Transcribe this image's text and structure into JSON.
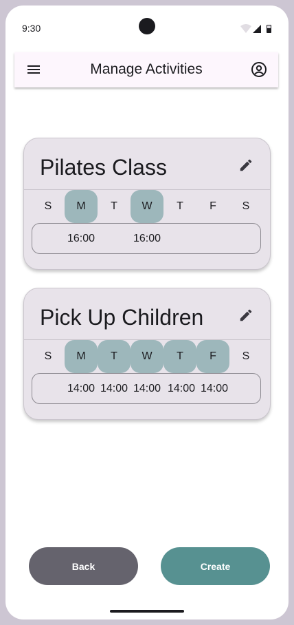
{
  "status_bar": {
    "time": "9:30"
  },
  "app_bar": {
    "title": "Manage Activities"
  },
  "activities": [
    {
      "title": "Pilates Class",
      "days": [
        {
          "label": "S",
          "selected": false,
          "time": ""
        },
        {
          "label": "M",
          "selected": true,
          "time": "16:00"
        },
        {
          "label": "T",
          "selected": false,
          "time": ""
        },
        {
          "label": "W",
          "selected": true,
          "time": "16:00"
        },
        {
          "label": "T",
          "selected": false,
          "time": ""
        },
        {
          "label": "F",
          "selected": false,
          "time": ""
        },
        {
          "label": "S",
          "selected": false,
          "time": ""
        }
      ]
    },
    {
      "title": "Pick Up Children",
      "days": [
        {
          "label": "S",
          "selected": false,
          "time": ""
        },
        {
          "label": "M",
          "selected": true,
          "time": "14:00"
        },
        {
          "label": "T",
          "selected": true,
          "time": "14:00"
        },
        {
          "label": "W",
          "selected": true,
          "time": "14:00"
        },
        {
          "label": "T",
          "selected": true,
          "time": "14:00"
        },
        {
          "label": "F",
          "selected": true,
          "time": "14:00"
        },
        {
          "label": "S",
          "selected": false,
          "time": ""
        }
      ]
    }
  ],
  "buttons": {
    "back": "Back",
    "create": "Create"
  },
  "colors": {
    "selected_day": "#9db7bb",
    "back_button": "#65636d",
    "create_button": "#579191",
    "card_background": "#e8e3ea"
  },
  "icons": {
    "menu": "menu-icon",
    "account": "account-circle-icon",
    "edit": "pencil-edit-icon"
  }
}
